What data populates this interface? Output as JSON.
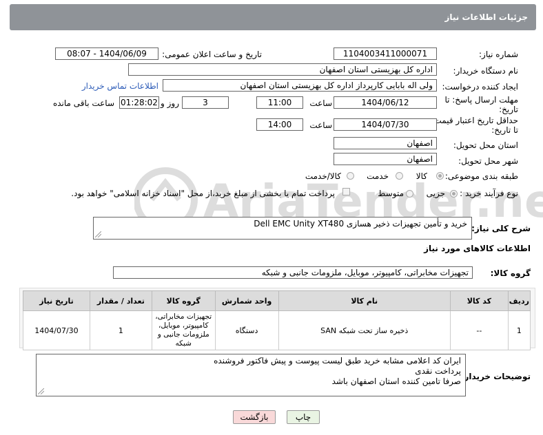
{
  "header": {
    "title": "جزئیات اطلاعات نیاز"
  },
  "form": {
    "need_number_label": "شماره نیاز:",
    "need_number": "1104003411000071",
    "announce_label": "تاریخ و ساعت اعلان عمومی:",
    "announce_value": "1404/06/09 - 08:07",
    "buyer_org_label": "نام دستگاه خریدار:",
    "buyer_org": "اداره کل بهزیستی استان اصفهان",
    "creator_label": "ایجاد کننده درخواست:",
    "creator": "ولی اله بابایی کارپرداز اداره کل بهزیستی استان اصفهان",
    "contact_link": "اطلاعات تماس خریدار",
    "deadline_label_1": "مهلت ارسال پاسخ: تا",
    "deadline_label_2": "تاریخ:",
    "deadline_date": "1404/06/12",
    "time_label": "ساعت",
    "deadline_time": "11:00",
    "days_value": "3",
    "days_label": "روز و",
    "remaining_time": "01:28:02",
    "remaining_label": "ساعت باقی مانده",
    "min_validity_label_1": "حداقل تاریخ اعتبار قیمت:",
    "min_validity_label_2": "تا تاریخ:",
    "validity_date": "1404/07/30",
    "validity_time": "14:00",
    "province_label": "استان محل تحویل:",
    "province": "اصفهان",
    "city_label": "شهر محل تحویل:",
    "city": "اصفهان",
    "category_label": "طبقه بندی موضوعی:",
    "category_options": [
      "کالا",
      "خدمت",
      "کالا/خدمت"
    ],
    "process_label": "نوع فرآیند خرید :",
    "process_options": [
      "جزیی",
      "متوسط"
    ],
    "payment_note": "پرداخت تمام یا بخشی از مبلغ خرید،از محل \"اسناد خزانه اسلامی\" خواهد بود.",
    "description_label": "شرح کلی نیاز:",
    "description": "خرید و تأمین تجهیزات ذخیر هسازی Dell EMC Unity XT480"
  },
  "goods": {
    "section_title": "اطلاعات کالاهای مورد نیاز",
    "group_label": "گروه کالا:",
    "group_value": "تجهیزات مخابراتی، کامپیوتر، موبایل، ملزومات جانبی و شبکه",
    "columns": [
      "ردیف",
      "کد کالا",
      "نام کالا",
      "واحد شمارش",
      "گروه کالا",
      "تعداد / مقدار",
      "تاریخ نیاز"
    ],
    "rows": [
      [
        "1",
        "--",
        "ذخیره ساز تحت شبکه SAN",
        "دستگاه",
        "تجهیزات مخابراتی، کامپیوتر، موبایل، ملزومات جانبی و شبکه",
        "1",
        "1404/07/30"
      ]
    ]
  },
  "buyer_notes": {
    "label": "توضیحات خریدار:",
    "lines": [
      "ایران کد اعلامی مشابه خرید طبق لیست پیوست و پیش فاکتور فروشنده",
      "پرداخت نقدی",
      "صرفا تامین کننده استان اصفهان باشد"
    ]
  },
  "buttons": {
    "print": "چاپ",
    "back": "بازگشت"
  },
  "watermark": "AriaTender.net",
  "colors": {
    "header_bg": "#8f9398",
    "link": "#2c5bb7",
    "back_button_bg": "#f9d9d9",
    "print_button_bg": "#e9f4e3"
  }
}
